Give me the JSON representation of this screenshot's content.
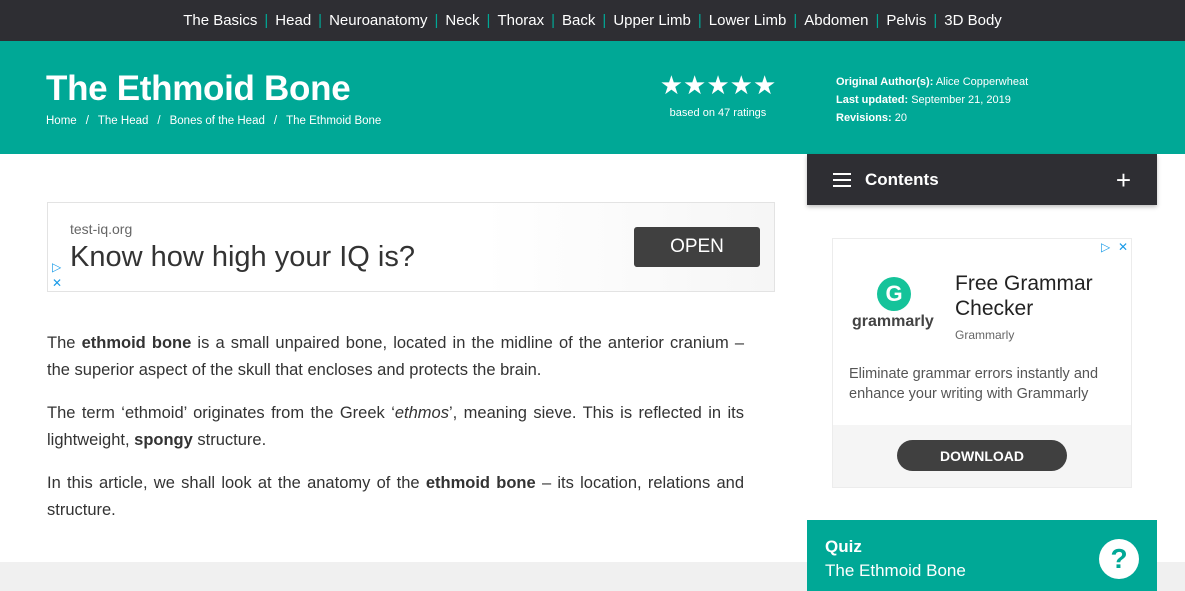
{
  "nav": {
    "items": [
      "The Basics",
      "Head",
      "Neuroanatomy",
      "Neck",
      "Thorax",
      "Back",
      "Upper Limb",
      "Lower Limb",
      "Abdomen",
      "Pelvis",
      "3D Body"
    ],
    "separator": "|"
  },
  "header": {
    "title": "The Ethmoid Bone",
    "breadcrumbs": [
      "Home",
      "The Head",
      "Bones of the Head",
      "The Ethmoid Bone"
    ],
    "breadcrumb_separator": "/",
    "rating": {
      "stars": "★★★★★",
      "value": 5,
      "max": 5,
      "text": "based on 47 ratings"
    },
    "meta": {
      "author_label": "Original Author(s):",
      "author": "Alice Copperwheat",
      "updated_label": "Last updated:",
      "updated": "September 21, 2019",
      "revisions_label": "Revisions:",
      "revisions": "20"
    }
  },
  "contents": {
    "label": "Contents",
    "toggle": "+"
  },
  "ad1": {
    "domain": "test-iq.org",
    "headline": "Know how high your IQ is?",
    "button": "OPEN",
    "adchoice": "▷",
    "close": "✕"
  },
  "article": {
    "p1": {
      "a": "The ",
      "b": "ethmoid bone",
      "c": " is a small unpaired bone, located in the midline of the anterior cranium – the superior aspect of the skull that encloses and protects the brain."
    },
    "p2": {
      "a": "The term ‘ethmoid’ originates from the Greek ‘",
      "em": "ethmos",
      "b": "’, meaning sieve. This is reflected in its lightweight, ",
      "strong": "spongy",
      "c": " structure."
    },
    "p3": {
      "a": "In this article, we shall look at the anatomy of the ",
      "b": "ethmoid bone",
      "c": " – its location, relations and structure."
    }
  },
  "ad2": {
    "logo_letter": "G",
    "logo_text": "grammarly",
    "title": "Free Grammar Checker",
    "advertiser": "Grammarly",
    "description": "Eliminate grammar errors instantly and enhance your writing with Grammarly",
    "button": "DOWNLOAD",
    "adchoice": "▷",
    "close": "✕"
  },
  "quiz": {
    "label": "Quiz",
    "subtitle": "The Ethmoid Bone",
    "icon": "?"
  },
  "colors": {
    "teal": "#00a896",
    "dark": "#2e2e33",
    "adblue": "#1a9be8",
    "grammarly": "#15c39a"
  }
}
